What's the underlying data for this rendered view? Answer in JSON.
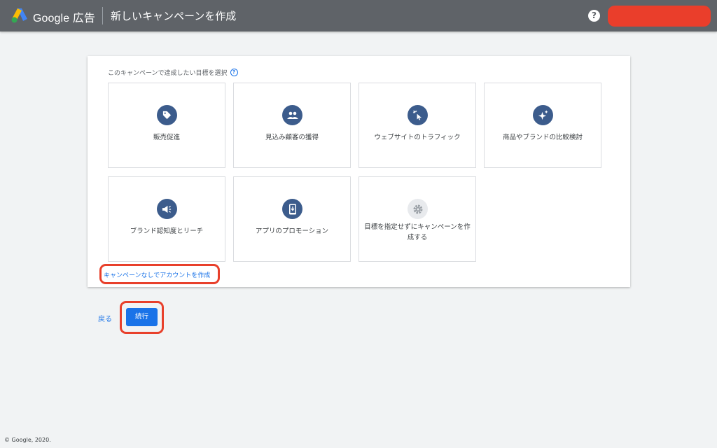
{
  "topbar": {
    "brand": "Google 広告",
    "page_title": "新しいキャンペーンを作成",
    "help_glyph": "?"
  },
  "card": {
    "heading": "このキャンペーンで達成したい目標を選択",
    "help_glyph": "?"
  },
  "goals": [
    {
      "label": "販売促進",
      "icon": "tag-icon"
    },
    {
      "label": "見込み顧客の獲得",
      "icon": "people-icon"
    },
    {
      "label": "ウェブサイトのトラフィック",
      "icon": "cursor-click-icon"
    },
    {
      "label": "商品やブランドの比較検討",
      "icon": "sparkle-icon"
    },
    {
      "label": "ブランド認知度とリーチ",
      "icon": "megaphone-icon"
    },
    {
      "label": "アプリのプロモーション",
      "icon": "phone-download-icon"
    },
    {
      "label": "目標を指定せずにキャンペーンを作成する",
      "icon": "gear-icon"
    }
  ],
  "links": {
    "no_campaign": "キャンペーンなしでアカウントを作成",
    "back": "戻る"
  },
  "buttons": {
    "continue": "続行"
  },
  "footer": {
    "copyright": "© Google, 2020."
  },
  "colors": {
    "topbar": "#5f6368",
    "icon_circle": "#3c5c8c",
    "link": "#1a73e8",
    "primary_button": "#1a73e8",
    "highlight": "#e8402b",
    "account_chip": "#ea3e2b"
  }
}
